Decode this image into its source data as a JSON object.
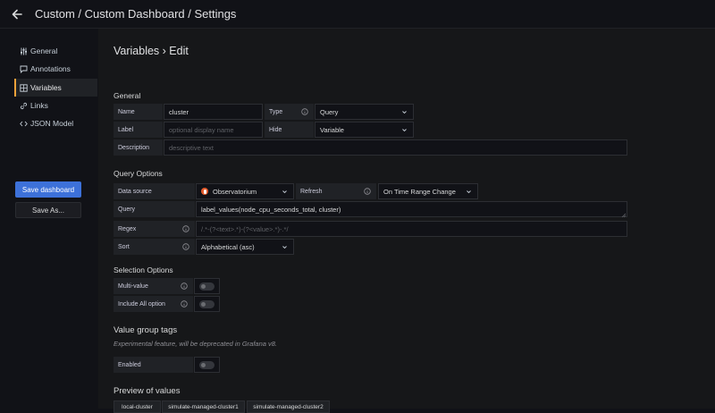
{
  "header": {
    "breadcrumb": "Custom / Custom Dashboard / Settings"
  },
  "sidebar": {
    "items": [
      {
        "label": "General",
        "icon": "sliders-icon"
      },
      {
        "label": "Annotations",
        "icon": "comment-icon"
      },
      {
        "label": "Variables",
        "icon": "calculator-icon",
        "active": true
      },
      {
        "label": "Links",
        "icon": "link-icon"
      },
      {
        "label": "JSON Model",
        "icon": "code-icon"
      }
    ],
    "save_dashboard": "Save dashboard",
    "save_as": "Save As..."
  },
  "page": {
    "title": "Variables › Edit",
    "general": {
      "heading": "General",
      "name_label": "Name",
      "name_value": "cluster",
      "type_label": "Type",
      "type_value": "Query",
      "label_label": "Label",
      "label_placeholder": "optional display name",
      "hide_label": "Hide",
      "hide_value": "Variable",
      "description_label": "Description",
      "description_placeholder": "descriptive text"
    },
    "query_options": {
      "heading": "Query Options",
      "data_source_label": "Data source",
      "data_source_value": "Observatorium",
      "refresh_label": "Refresh",
      "refresh_value": "On Time Range Change",
      "query_label": "Query",
      "query_value": "label_values(node_cpu_seconds_total, cluster)",
      "regex_label": "Regex",
      "regex_placeholder": "/.*-(?<text>.*)-(?<value>.*)-.*/",
      "sort_label": "Sort",
      "sort_value": "Alphabetical (asc)"
    },
    "selection_options": {
      "heading": "Selection Options",
      "multi_value_label": "Multi-value",
      "multi_value": false,
      "include_all_label": "Include All option",
      "include_all": false
    },
    "value_group_tags": {
      "heading": "Value group tags",
      "note": "Experimental feature, will be deprecated in Grafana v8.",
      "enabled_label": "Enabled",
      "enabled": false
    },
    "preview": {
      "heading": "Preview of values",
      "values": [
        "local-cluster",
        "simulate-managed-cluster1",
        "simulate-managed-cluster2"
      ]
    }
  },
  "colors": {
    "accent_active": "#f2a13a",
    "primary_button": "#3d71d9",
    "datasource_icon": "#e45a2b"
  }
}
